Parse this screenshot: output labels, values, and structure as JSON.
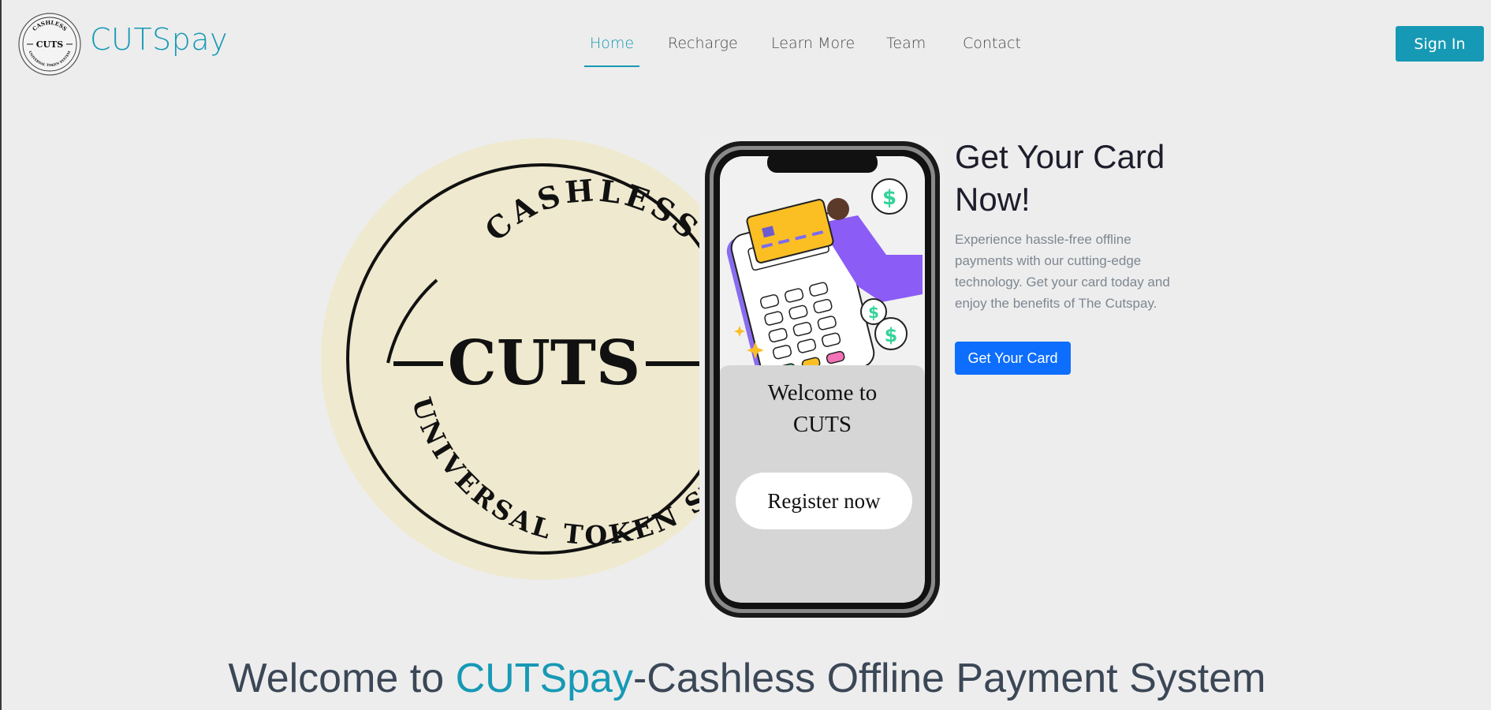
{
  "header": {
    "brand": "CUTSpay",
    "logo_text": {
      "top": "CASHLESS",
      "center": "CUTS",
      "bottom": "UNIVERSAL TOKEN SYSTEM"
    },
    "nav": [
      {
        "label": "Home",
        "active": true
      },
      {
        "label": "Recharge",
        "active": false
      },
      {
        "label": "Learn More",
        "active": false
      },
      {
        "label": "Team",
        "active": false
      },
      {
        "label": "Contact",
        "active": false
      }
    ],
    "signin_label": "Sign In"
  },
  "hero": {
    "logo_text": {
      "top": "CASHLESS",
      "center": "CUTS",
      "bottom": "UNIVERSAL TOKEN SYSTEM"
    },
    "phone": {
      "welcome_line1": "Welcome to",
      "welcome_line2": "CUTS",
      "register_label": "Register now"
    },
    "card_title": "Get Your Card Now!",
    "card_description": "Experience hassle-free offline payments with our cutting-edge technology. Get your card today and enjoy the benefits of The Cutspay.",
    "card_button": "Get Your Card"
  },
  "welcome": {
    "prefix": "Welcome to ",
    "brand": "CUTSpay",
    "suffix": "-Cashless Offline Payment System"
  },
  "colors": {
    "brand": "#1699b5",
    "primary_button": "#0d6efd",
    "background": "#ededed",
    "logo_fill": "#efe9cf"
  }
}
